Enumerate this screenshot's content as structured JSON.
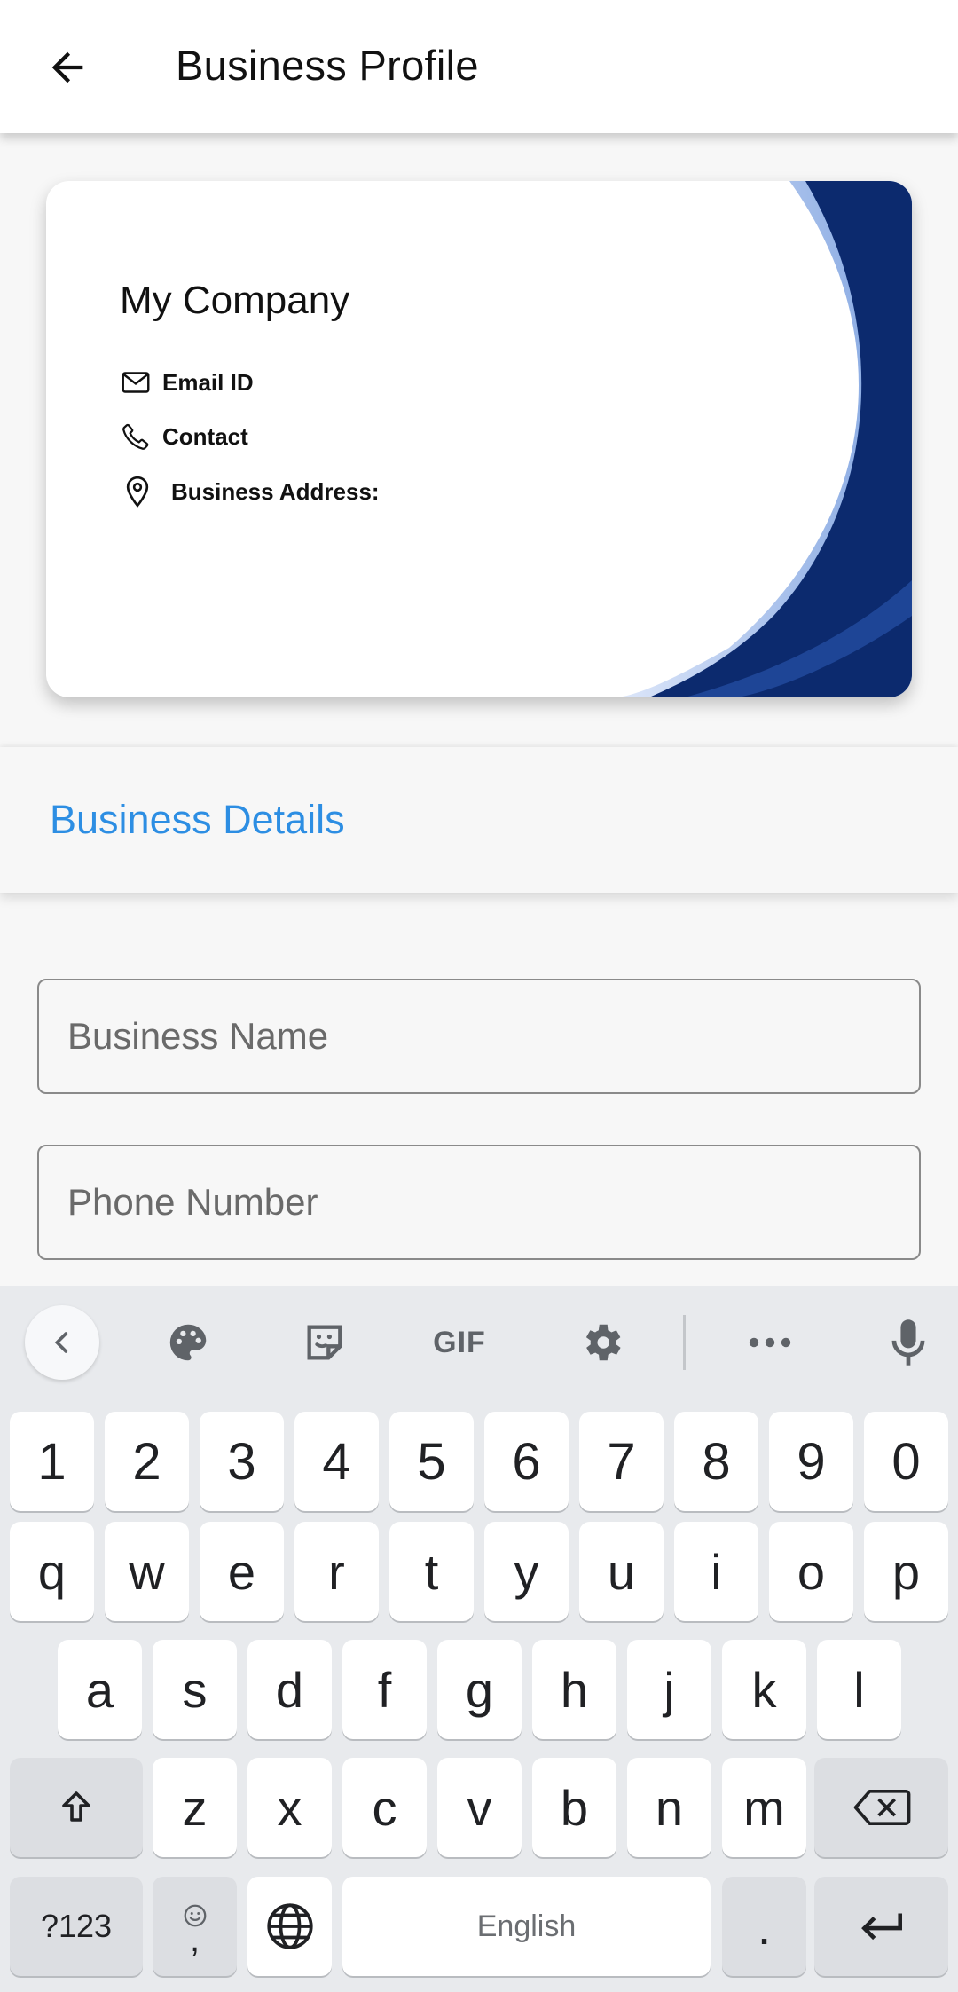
{
  "appbar": {
    "title": "Business Profile",
    "back_icon": "arrow-back-icon"
  },
  "card": {
    "company_name": "My Company",
    "email_label": "Email ID",
    "contact_label": "Contact",
    "address_label": "Business Address:",
    "colors": {
      "wave_dark": "#0c2a6e",
      "wave_light": "#a9c3ee"
    }
  },
  "section": {
    "title": "Business Details",
    "color": "#2d8ee3"
  },
  "form": {
    "business_name": {
      "value": "",
      "placeholder": "Business Name"
    },
    "phone_number": {
      "value": "",
      "placeholder": "Phone Number"
    }
  },
  "keyboard": {
    "toolbar": [
      "chevron-left-icon",
      "palette-icon",
      "sticker-icon",
      "gif-icon",
      "settings-icon",
      "more-icon",
      "mic-icon"
    ],
    "gif_label": "GIF",
    "row_numbers": [
      "1",
      "2",
      "3",
      "4",
      "5",
      "6",
      "7",
      "8",
      "9",
      "0"
    ],
    "row_q": [
      "q",
      "w",
      "e",
      "r",
      "t",
      "y",
      "u",
      "i",
      "o",
      "p"
    ],
    "row_a": [
      "a",
      "s",
      "d",
      "f",
      "g",
      "h",
      "j",
      "k",
      "l"
    ],
    "row_z": [
      "z",
      "x",
      "c",
      "v",
      "b",
      "n",
      "m"
    ],
    "symbols_label": "?123",
    "comma_label": ",",
    "space_label": "English",
    "period_label": "."
  }
}
